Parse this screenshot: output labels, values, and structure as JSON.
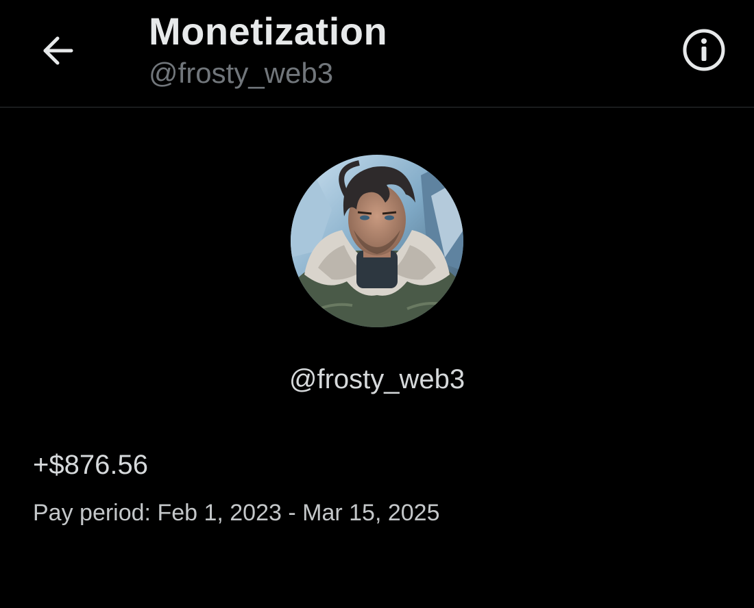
{
  "header": {
    "title": "Monetization",
    "subtitle": "@frosty_web3",
    "back_icon": "arrow-left-icon",
    "info_icon": "info-circle-icon"
  },
  "profile": {
    "avatar": "profile-avatar-image",
    "handle": "@frosty_web3"
  },
  "earnings": {
    "amount": "+$876.56",
    "pay_period": "Pay period: Feb 1, 2023 - Mar 15, 2025"
  },
  "colors": {
    "background": "#000000",
    "primary_text": "#e7e9ea",
    "secondary_text": "#71767b",
    "divider": "#2f3336"
  }
}
